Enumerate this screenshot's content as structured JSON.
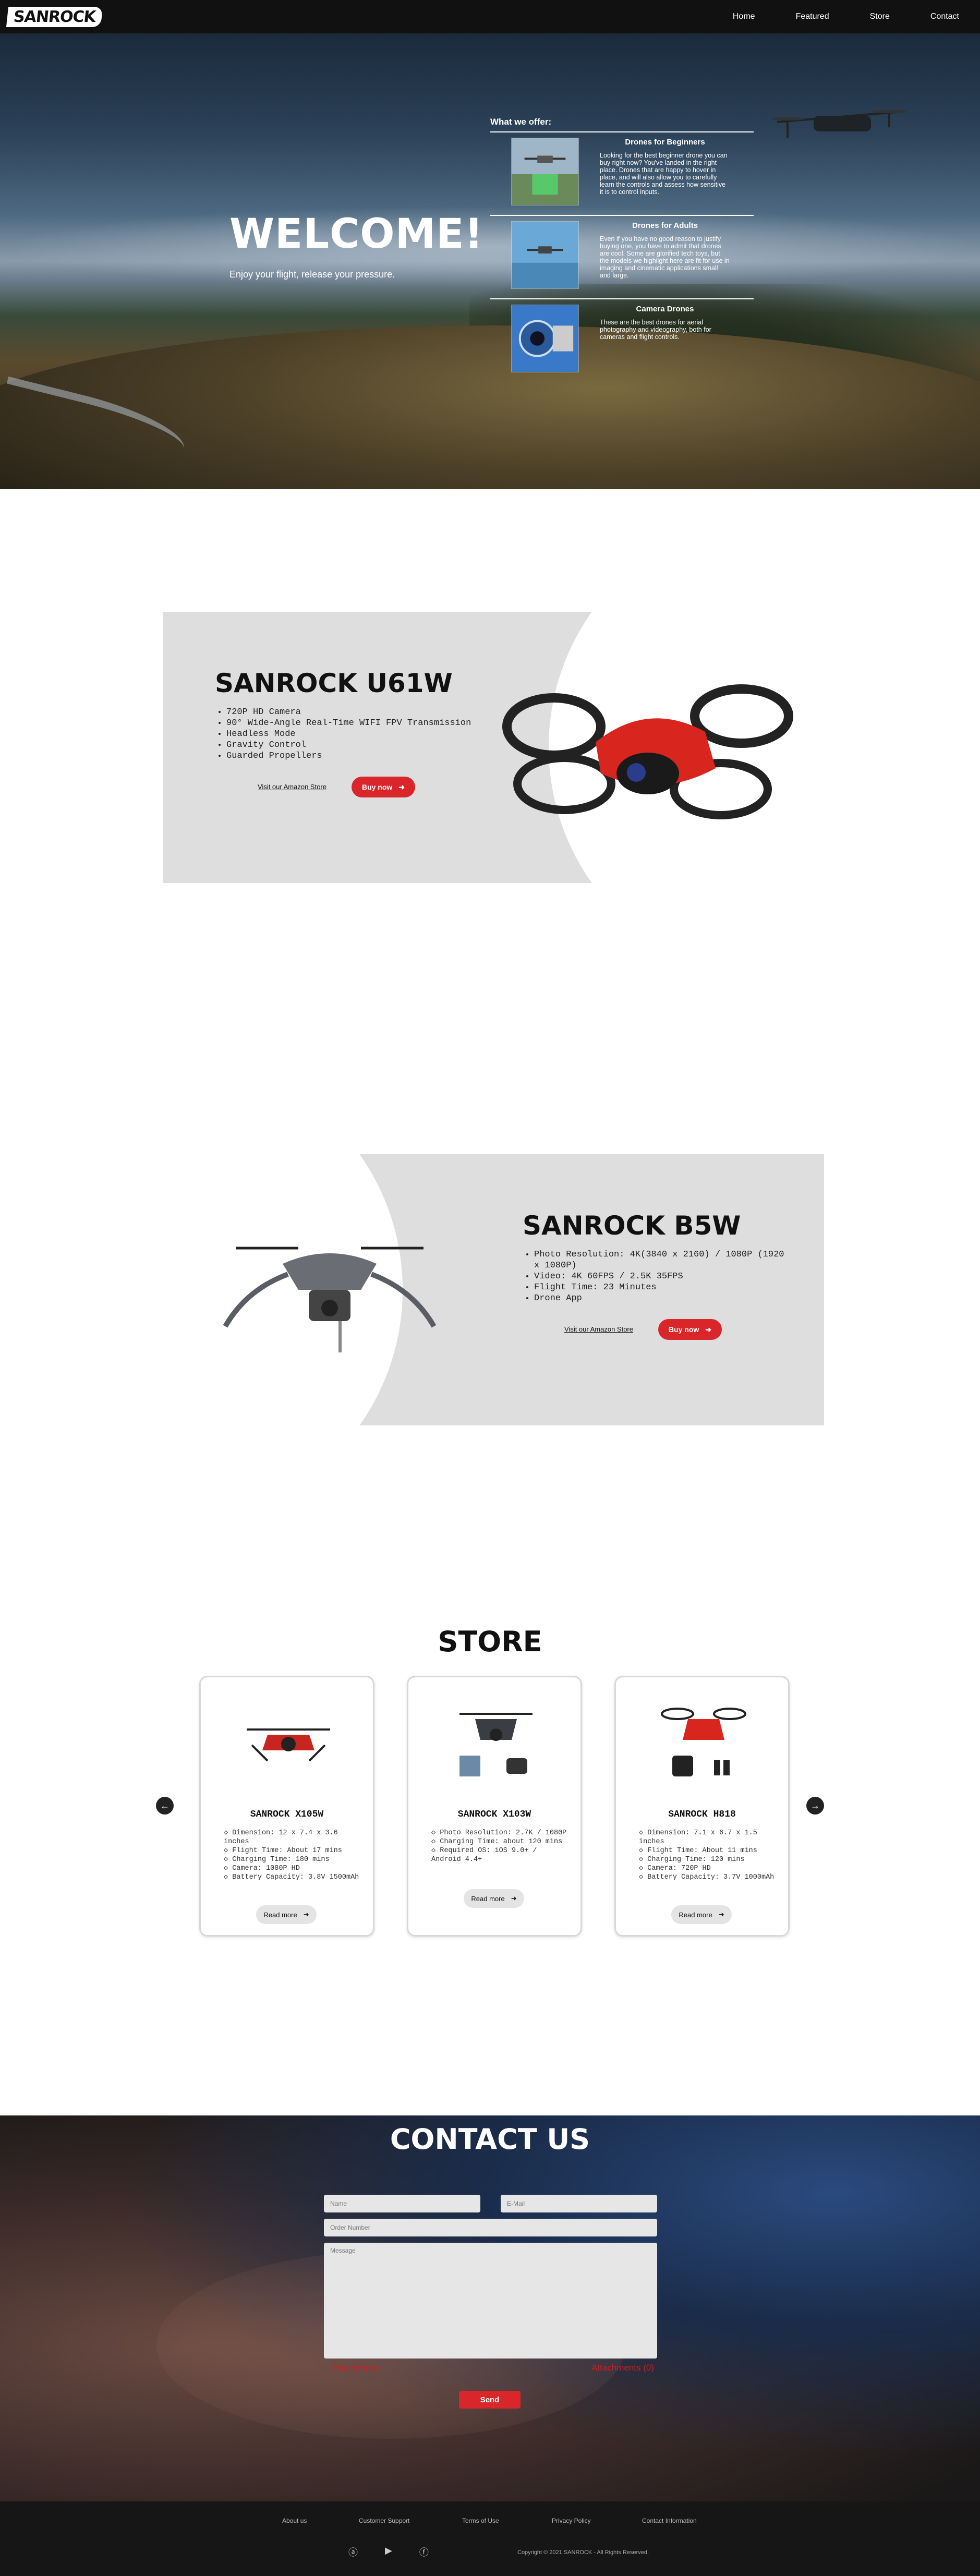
{
  "nav": {
    "logo": "SANROCK",
    "links": [
      "Home",
      "Featured",
      "Store",
      "Contact"
    ]
  },
  "hero": {
    "title": "WELCOME!",
    "tagline": "Enjoy your flight, release your pressure.",
    "offer_title": "What we offer:",
    "offers": [
      {
        "title": "Drones for Beginners",
        "text": "Looking for the best beginner drone you can buy right now? You've landed in the right place. Drones that are happy to hover in place, and will also allow you to carefully learn the controls and assess how sensitive it is to control inputs."
      },
      {
        "title": "Drones for Adults",
        "text": "Even if you have no good reason to justify buying one, you have to admit that drones are cool. Some are glorified tech toys, but the models we highlight here are fit for use in imaging and cinematic applications small and large."
      },
      {
        "title": "Camera Drones",
        "text": "These are the best drones for aerial photography and videography, both for cameras and flight controls."
      }
    ]
  },
  "products": [
    {
      "name": "SANROCK U61W",
      "features": [
        "720P HD Camera",
        "90° Wide-Angle Real-Time WIFI FPV Transmission",
        "Headless Mode",
        "Gravity Control",
        "Guarded Propellers"
      ],
      "amazon_link": "Visit our Amazon Store",
      "buy_label": "Buy now"
    },
    {
      "name": "SANROCK B5W",
      "features": [
        "Photo Resolution: 4K(3840 x 2160) / 1080P (1920 x 1080P)",
        "Video: 4K 60FPS / 2.5K 35FPS",
        "Flight Time: 23 Minutes",
        "Drone App"
      ],
      "amazon_link": "Visit our Amazon Store",
      "buy_label": "Buy now"
    }
  ],
  "store": {
    "title": "STORE",
    "prev_icon": "arrow-left-icon",
    "next_icon": "arrow-right-icon",
    "read_more": "Read more",
    "items": [
      {
        "name": "SANROCK X105W",
        "specs": [
          "Dimension: 12 x 7.4 x 3.6 inches",
          "Flight Time: About 17 mins",
          "Charging Time: 180 mins",
          "Camera: 1080P HD",
          "Battery Capacity: 3.8V 1500mAh"
        ]
      },
      {
        "name": "SANROCK X103W",
        "specs": [
          "Photo Resolution: 2.7K / 1080P",
          "Charging Time: about 120 mins",
          "Required OS: iOS 9.0+ / Android 4.4+"
        ]
      },
      {
        "name": "SANROCK H818",
        "specs": [
          "Dimension: 7.1 x 6.7 x 1.5 inches",
          "Flight Time: About 11 mins",
          "Charging Time: 120 mins",
          "Camera: 720P HD",
          "Battery Capacity: 3.7V 1000mAh"
        ]
      }
    ]
  },
  "contact": {
    "title": "CONTACT US",
    "name_placeholder": "Name",
    "email_placeholder": "E-Mail",
    "order_placeholder": "Order Number",
    "message_placeholder": "Message",
    "attachment_left": "Attachment",
    "attachment_right": "Attachments (0)",
    "send_label": "Send"
  },
  "footer": {
    "links": [
      "About us",
      "Customer Support",
      "Terms of Use",
      "Privacy Policy",
      "Contact Information"
    ],
    "copyright": "Copyright © 2021 SANROCK - All Rights Reserved."
  },
  "colors": {
    "accent": "#d9262a",
    "panel": "#dedede",
    "nav": "#111111"
  }
}
